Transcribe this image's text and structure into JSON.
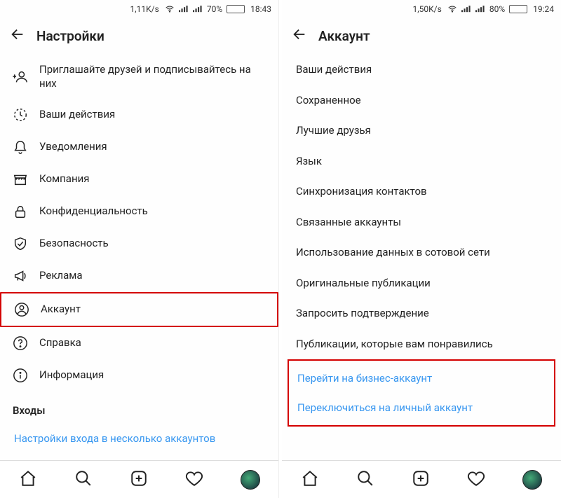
{
  "left": {
    "status": {
      "speed": "1,11K/s",
      "battery_pct": "70%",
      "battery_fill": "70%",
      "time": "18:43"
    },
    "header": {
      "title": "Настройки"
    },
    "rows": [
      {
        "label": "Приглашайте друзей и подписывайтесь на них"
      },
      {
        "label": "Ваши действия"
      },
      {
        "label": "Уведомления"
      },
      {
        "label": "Компания"
      },
      {
        "label": "Конфиденциальность"
      },
      {
        "label": "Безопасность"
      },
      {
        "label": "Реклама"
      },
      {
        "label": "Аккаунт"
      },
      {
        "label": "Справка"
      },
      {
        "label": "Информация"
      }
    ],
    "section": "Входы",
    "link": "Настройки входа в несколько аккаунтов"
  },
  "right": {
    "status": {
      "speed": "1,50K/s",
      "battery_pct": "80%",
      "battery_fill": "80%",
      "time": "19:24"
    },
    "header": {
      "title": "Аккаунт"
    },
    "rows": [
      {
        "label": "Ваши действия"
      },
      {
        "label": "Сохраненное"
      },
      {
        "label": "Лучшие друзья"
      },
      {
        "label": "Язык"
      },
      {
        "label": "Синхронизация контактов"
      },
      {
        "label": "Связанные аккаунты"
      },
      {
        "label": "Использование данных в сотовой сети"
      },
      {
        "label": "Оригинальные публикации"
      },
      {
        "label": "Запросить подтверждение"
      },
      {
        "label": "Публикации, которые вам понравились"
      }
    ],
    "links": [
      "Перейти на бизнес-аккаунт",
      "Переключиться на личный аккаунт"
    ]
  }
}
